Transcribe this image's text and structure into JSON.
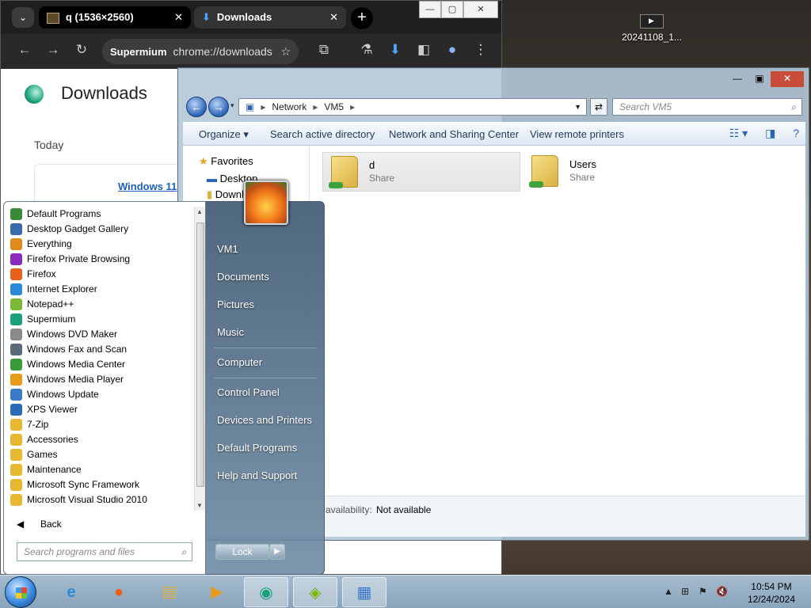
{
  "desktop": {
    "icon_label": "20241108_1..."
  },
  "chrome": {
    "tabs": [
      {
        "title": "q (1536×2560)"
      },
      {
        "title": "Downloads"
      }
    ],
    "address_chip": "Supermium",
    "address": "chrome://downloads",
    "page_title": "Downloads",
    "section_today": "Today",
    "download_link": "Windows 11"
  },
  "explorer": {
    "address": [
      "Network",
      "VM5"
    ],
    "search_placeholder": "Search VM5",
    "commands": [
      "Organize",
      "Search active directory",
      "Network and Sharing Center",
      "View remote printers"
    ],
    "nav": {
      "favorites": "Favorites",
      "desktop": "Desktop",
      "downloads": "Downloads"
    },
    "items": [
      {
        "name": "d",
        "type": "Share"
      },
      {
        "name": "Users",
        "type": "Share"
      }
    ],
    "details_label": "availability:",
    "details_value": "Not available"
  },
  "start_menu": {
    "programs": [
      {
        "label": "Default Programs",
        "color": "#3a8a3a"
      },
      {
        "label": "Desktop Gadget Gallery",
        "color": "#3a6aa8"
      },
      {
        "label": "Everything",
        "color": "#e08a1a"
      },
      {
        "label": "Firefox Private Browsing",
        "color": "#8a2ac0"
      },
      {
        "label": "Firefox",
        "color": "#e8601a"
      },
      {
        "label": "Internet Explorer",
        "color": "#2a8ad8"
      },
      {
        "label": "Notepad++",
        "color": "#7ab83a"
      },
      {
        "label": "Supermium",
        "color": "#1aa07a"
      },
      {
        "label": "Windows DVD Maker",
        "color": "#8a8a8a"
      },
      {
        "label": "Windows Fax and Scan",
        "color": "#5a6a7a"
      },
      {
        "label": "Windows Media Center",
        "color": "#3a9a3a"
      },
      {
        "label": "Windows Media Player",
        "color": "#e89a1a"
      },
      {
        "label": "Windows Update",
        "color": "#3a7ac8"
      },
      {
        "label": "XPS Viewer",
        "color": "#2a6ab8"
      },
      {
        "label": "7-Zip",
        "color": "#e8b830"
      },
      {
        "label": "Accessories",
        "color": "#e8b830"
      },
      {
        "label": "Games",
        "color": "#e8b830"
      },
      {
        "label": "Maintenance",
        "color": "#e8b830"
      },
      {
        "label": "Microsoft Sync Framework",
        "color": "#e8b830"
      },
      {
        "label": "Microsoft Visual Studio 2010",
        "color": "#e8b830"
      }
    ],
    "back": "Back",
    "search_placeholder": "Search programs and files",
    "right_links": [
      "VM1",
      "Documents",
      "Pictures",
      "Music",
      "Computer",
      "Control Panel",
      "Devices and Printers",
      "Default Programs",
      "Help and Support"
    ],
    "lock": "Lock"
  },
  "taskbar": {
    "time": "10:54 PM",
    "date": "12/24/2024"
  }
}
